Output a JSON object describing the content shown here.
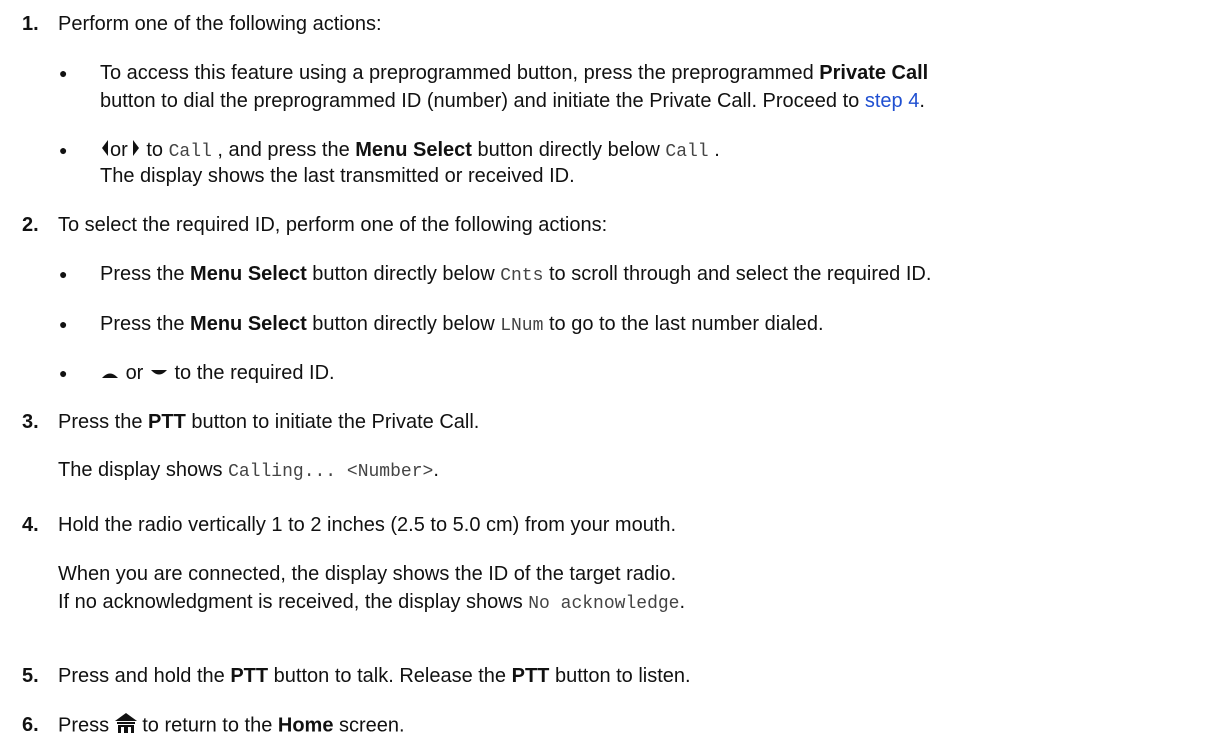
{
  "steps": [
    {
      "number": "1.",
      "intro": "Perform one of the following actions:",
      "bullets": [
        {
          "line1_before": "To access this feature using a preprogrammed button, press the preprogrammed ",
          "line1_bold": "Private Call",
          "line2_before": "button to dial the preprogrammed ID (number) and initiate the Private Call. Proceed to ",
          "line2_link": "step 4",
          "line2_after": "."
        },
        {
          "or": "or",
          "to": "to",
          "code": "Call",
          "mid": ", and press the ",
          "bold": "Menu Select",
          "after": " button directly below ",
          "code2": "Call",
          "end": ".",
          "line2": "The display shows the last transmitted or received ID.",
          "icons": [
            "left-arrow-icon",
            "right-arrow-icon"
          ]
        }
      ]
    },
    {
      "number": "2.",
      "intro": "To select the required ID, perform one of the following actions:",
      "bullets": [
        {
          "before": "Press the ",
          "bold": "Menu Select",
          "mid": " button directly below ",
          "code": "Cnts",
          "after": " to scroll through and select the required ID."
        },
        {
          "before": "Press the ",
          "bold": "Menu Select",
          "mid": " button directly below ",
          "code": "LNum",
          "after": " to go to the last number dialed."
        },
        {
          "or": "or",
          "after": "to the required ID.",
          "icons": [
            "up-arrow-icon",
            "down-arrow-icon"
          ]
        }
      ]
    },
    {
      "number": "3.",
      "before": "Press the ",
      "bold": "PTT",
      "after": " button to initiate the Private Call.",
      "result_before": "The display shows ",
      "result_code": "Calling... <Number>",
      "result_end": "."
    },
    {
      "number": "4.",
      "text": "Hold the radio vertically 1 to 2 inches (2.5 to 5.0 cm) from your mouth.",
      "result_line1": "When you are connected, the display shows the ID of the target radio.",
      "result_line2_before": "If no acknowledgment is received, the display shows ",
      "result_line2_code": "No acknowledge",
      "result_line2_end": "."
    },
    {
      "number": "5.",
      "before": "Press and hold the ",
      "bold1": "PTT",
      "mid": " button to talk. Release the ",
      "bold2": "PTT",
      "after": " button to listen."
    },
    {
      "number": "6.",
      "before": "Press ",
      "mid": " to return to the ",
      "bold": "Home",
      "after": " screen.",
      "icon": "home-icon"
    }
  ],
  "bullet_glyph": "●"
}
